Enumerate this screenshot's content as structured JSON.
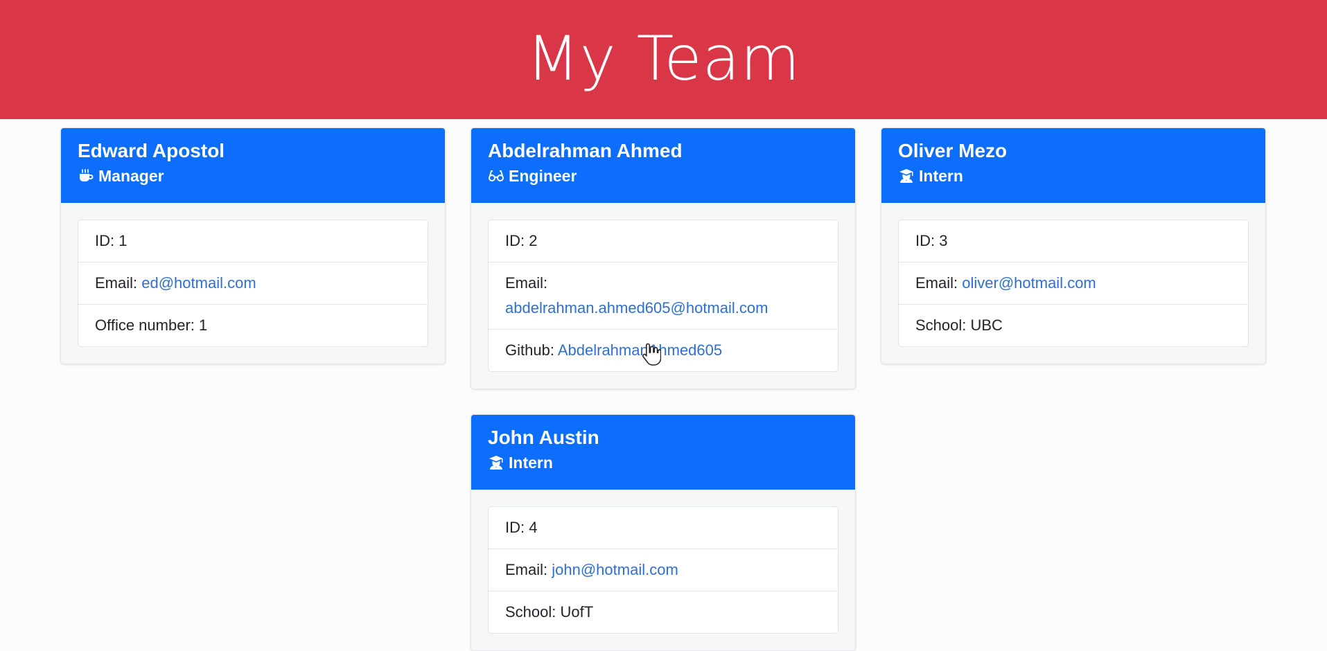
{
  "header": {
    "title": "My Team"
  },
  "colors": {
    "banner": "#d93647",
    "card_header": "#0d6efd",
    "link": "#2f6fd1"
  },
  "employees": [
    {
      "name": "Edward Apostol",
      "role": "Manager",
      "icon": "coffee-icon",
      "id_label": "ID: 1",
      "email_label": "Email:",
      "email": "ed@hotmail.com",
      "extra_label": "Office number: 1"
    },
    {
      "name": "Abdelrahman Ahmed",
      "role": "Engineer",
      "icon": "glasses-icon",
      "id_label": "ID: 2",
      "email_label": "Email:",
      "email": "abdelrahman.ahmed605@hotmail.com",
      "github_label": "Github:",
      "github": "AbdelrahmanAhmed605"
    },
    {
      "name": "Oliver Mezo",
      "role": "Intern",
      "icon": "graduate-icon",
      "id_label": "ID: 3",
      "email_label": "Email:",
      "email": "oliver@hotmail.com",
      "extra_label": "School: UBC"
    },
    {
      "name": "John Austin",
      "role": "Intern",
      "icon": "graduate-icon",
      "id_label": "ID: 4",
      "email_label": "Email:",
      "email": "john@hotmail.com",
      "extra_label": "School: UofT"
    }
  ]
}
